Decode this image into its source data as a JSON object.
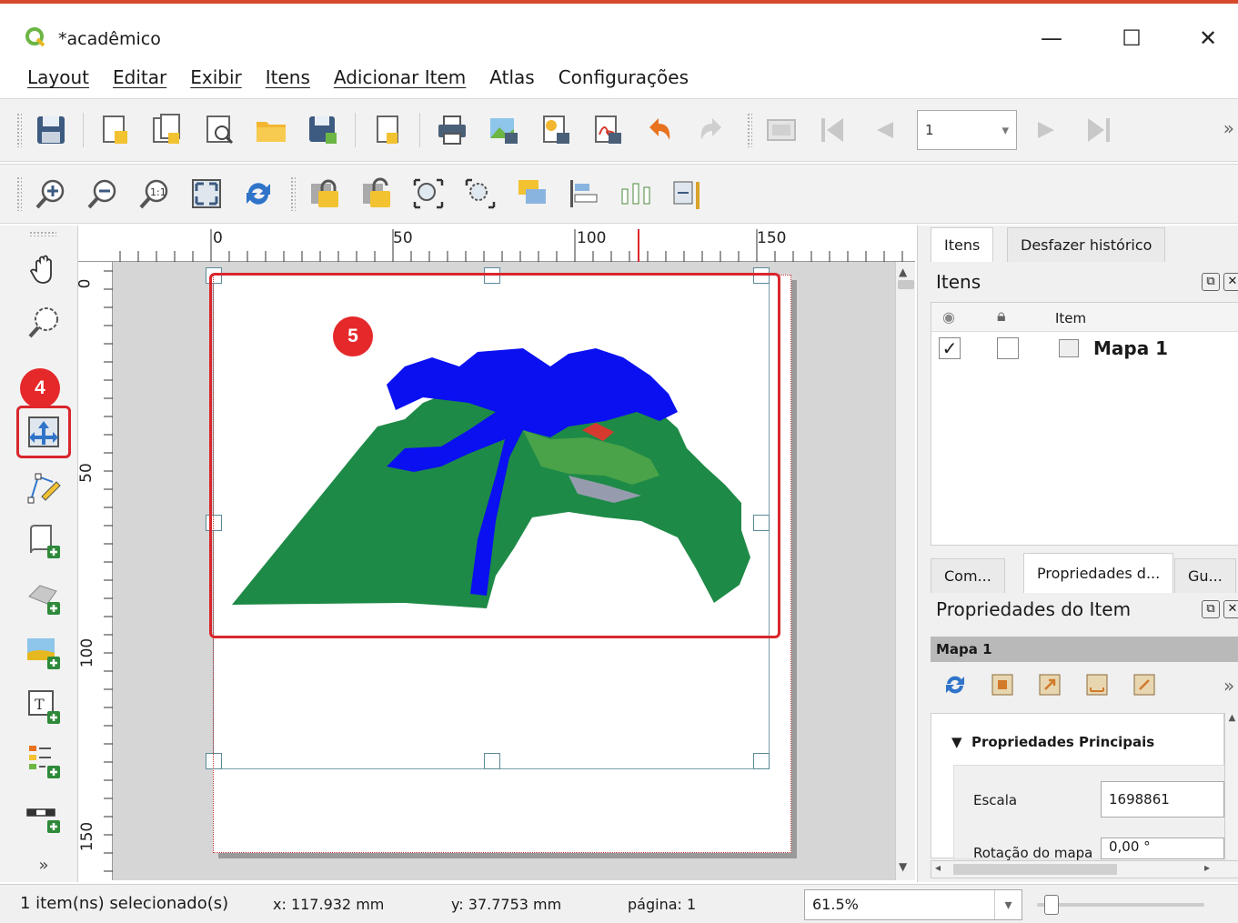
{
  "window": {
    "title": "*acadêmico",
    "minimize": "—",
    "maximize": "☐",
    "close": "✕"
  },
  "menu": [
    "Layout",
    "Editar",
    "Exibir",
    "Itens",
    "Adicionar Item",
    "Atlas",
    "Configurações"
  ],
  "toolbar_nav": {
    "page_value": "1",
    "overflow": "»"
  },
  "rulers": {
    "horizontal": [
      "0",
      "50",
      "100",
      "150"
    ],
    "vertical": [
      "0",
      "50",
      "100",
      "150"
    ]
  },
  "annotations": {
    "badge_4": "4",
    "badge_5": "5"
  },
  "items_panel": {
    "tabs": [
      "Itens",
      "Desfazer histórico"
    ],
    "title": "Itens",
    "column_item": "Item",
    "rows": [
      {
        "visible": "✓",
        "locked": "",
        "name": "Mapa 1"
      }
    ]
  },
  "props_panel": {
    "tabs": [
      "Com...",
      "Propriedades d...",
      "Gu..."
    ],
    "title": "Propriedades do Item",
    "item_name": "Mapa 1",
    "overflow": "»",
    "section": "Propriedades Principais",
    "scale_label": "Escala",
    "scale_value": "1698861",
    "rotation_label": "Rotação do mapa",
    "rotation_value": "0,00 °"
  },
  "status": {
    "selection": "1 item(ns) selecionado(s)",
    "x": "x: 117.932 mm",
    "y": "y: 37.7753 mm",
    "page": "página: 1",
    "zoom": "61.5%"
  },
  "colors": {
    "highlight": "#d9262c",
    "map_green": "#1e8a47",
    "map_blue": "#0a10f0"
  }
}
